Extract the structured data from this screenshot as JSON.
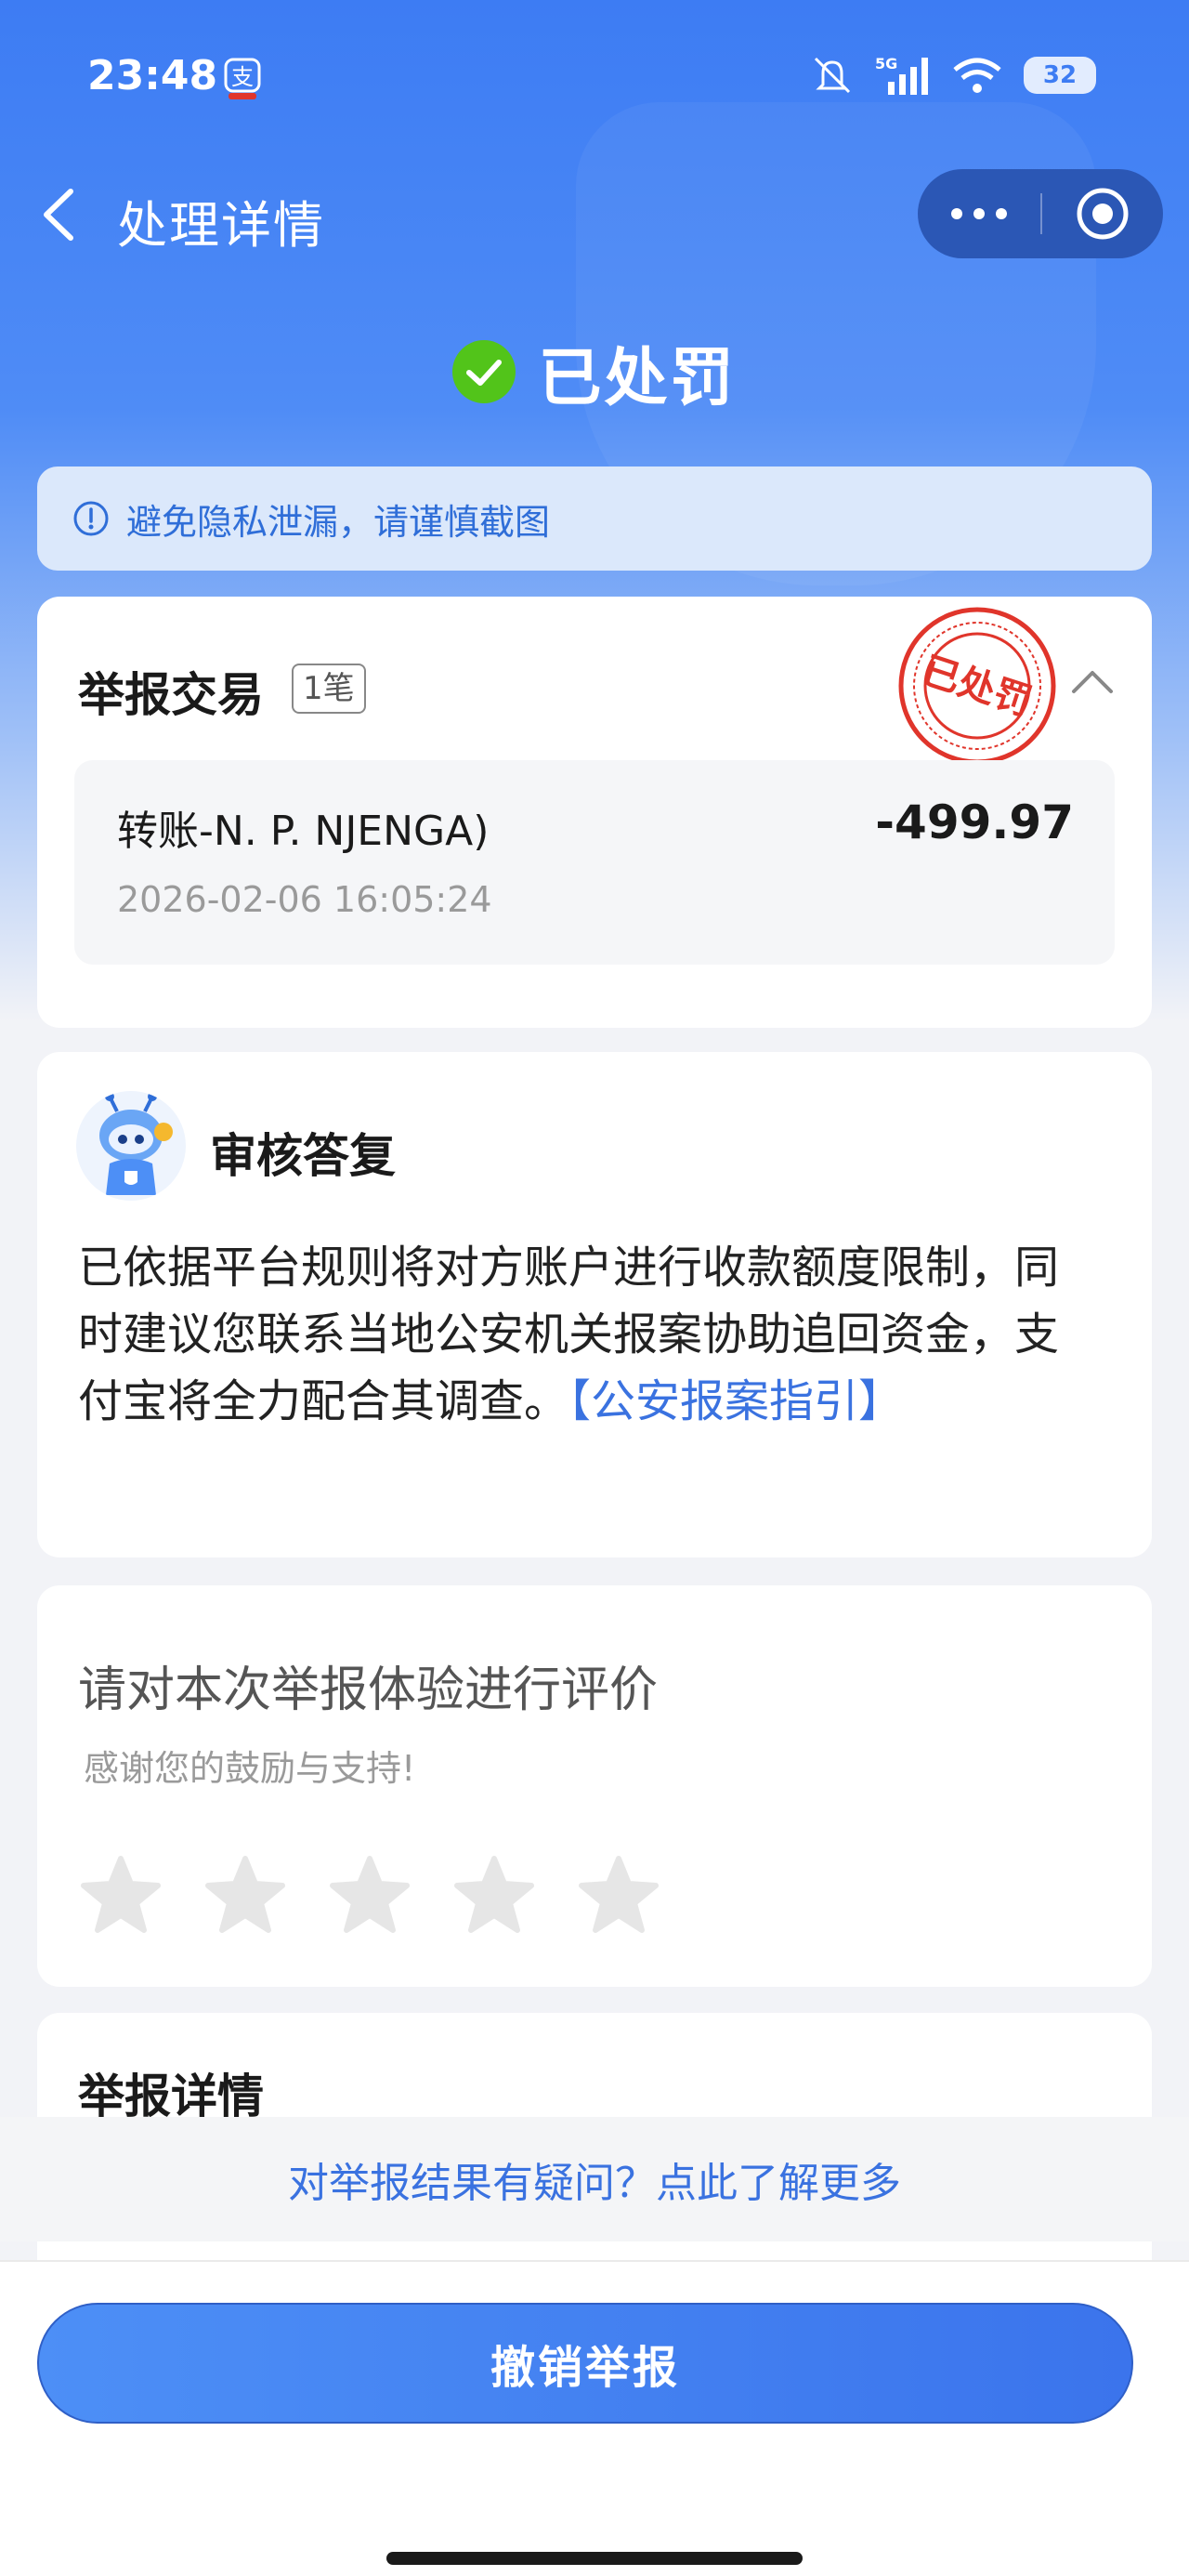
{
  "status_bar": {
    "time": "23:48",
    "battery": "32",
    "icons": [
      "mute-icon",
      "5g-signal-icon",
      "wifi-icon",
      "battery-icon"
    ]
  },
  "nav": {
    "title": "处理详情",
    "back_icon": "chevron-left-icon",
    "more_icon": "more-dots-icon",
    "close_icon": "target-circle-icon"
  },
  "status_header": {
    "text": "已处罚",
    "icon": "check-circle-icon",
    "icon_color": "#52c41a"
  },
  "privacy_tip": {
    "icon": "info-circle-icon",
    "text": "避免隐私泄漏，请谨慎截图"
  },
  "report_transaction": {
    "title": "举报交易",
    "count": "1笔",
    "stamp_text": "已处罚",
    "stamp_color": "#e0352b",
    "items": [
      {
        "name": "转账-N. P. NJENGA)",
        "amount": "-499.97",
        "time": "2026-02-06 16:05:24"
      }
    ]
  },
  "review_reply": {
    "title": "审核答复",
    "body": "已依据平台规则将对方账户进行收款额度限制，同时建议您联系当地公安机关报案协助追回资金，支付宝将全力配合其调查。",
    "link": "【公安报案指引】"
  },
  "rating": {
    "title": "请对本次举报体验进行评价",
    "subtitle": "感谢您的鼓励与支持!",
    "max_stars": 5,
    "selected": 0
  },
  "report_details": {
    "title": "举报详情"
  },
  "doubt_link": "对举报结果有疑问？点此了解更多",
  "revoke_button": "撤销举报",
  "colors": {
    "primary": "#3b74ec",
    "link": "#3a72e0",
    "background": "#f2f3f7"
  }
}
